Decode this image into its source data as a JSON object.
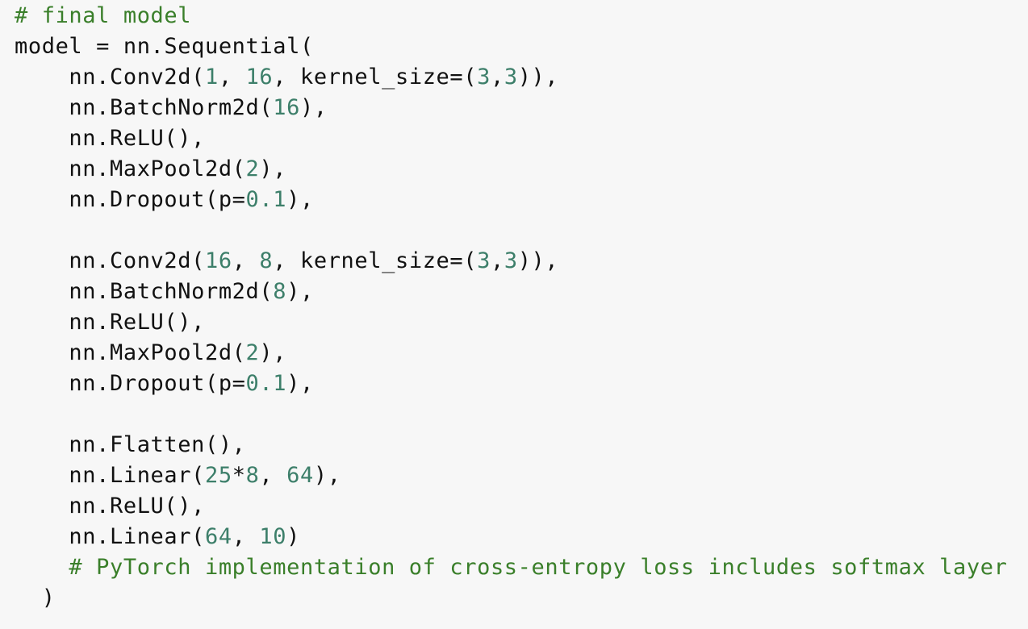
{
  "code_cell": {
    "colors": {
      "background": "#f7f7f7",
      "text": "#111111",
      "comment": "#3a7f2a",
      "number": "#3d7f6a"
    },
    "lines": [
      [
        {
          "t": "# final model",
          "c": "comment"
        }
      ],
      [
        {
          "t": "model = nn.Sequential(",
          "c": "plain"
        }
      ],
      [
        {
          "t": "    nn.Conv2d(",
          "c": "plain"
        },
        {
          "t": "1",
          "c": "num"
        },
        {
          "t": ", ",
          "c": "plain"
        },
        {
          "t": "16",
          "c": "num"
        },
        {
          "t": ", kernel_size=(",
          "c": "plain"
        },
        {
          "t": "3",
          "c": "num"
        },
        {
          "t": ",",
          "c": "plain"
        },
        {
          "t": "3",
          "c": "num"
        },
        {
          "t": ")),",
          "c": "plain"
        }
      ],
      [
        {
          "t": "    nn.BatchNorm2d(",
          "c": "plain"
        },
        {
          "t": "16",
          "c": "num"
        },
        {
          "t": "),",
          "c": "plain"
        }
      ],
      [
        {
          "t": "    nn.ReLU(),",
          "c": "plain"
        }
      ],
      [
        {
          "t": "    nn.MaxPool2d(",
          "c": "plain"
        },
        {
          "t": "2",
          "c": "num"
        },
        {
          "t": "),",
          "c": "plain"
        }
      ],
      [
        {
          "t": "    nn.Dropout(p=",
          "c": "plain"
        },
        {
          "t": "0.1",
          "c": "num"
        },
        {
          "t": "),",
          "c": "plain"
        }
      ],
      [],
      [
        {
          "t": "    nn.Conv2d(",
          "c": "plain"
        },
        {
          "t": "16",
          "c": "num"
        },
        {
          "t": ", ",
          "c": "plain"
        },
        {
          "t": "8",
          "c": "num"
        },
        {
          "t": ", kernel_size=(",
          "c": "plain"
        },
        {
          "t": "3",
          "c": "num"
        },
        {
          "t": ",",
          "c": "plain"
        },
        {
          "t": "3",
          "c": "num"
        },
        {
          "t": ")),",
          "c": "plain"
        }
      ],
      [
        {
          "t": "    nn.BatchNorm2d(",
          "c": "plain"
        },
        {
          "t": "8",
          "c": "num"
        },
        {
          "t": "),",
          "c": "plain"
        }
      ],
      [
        {
          "t": "    nn.ReLU(),",
          "c": "plain"
        }
      ],
      [
        {
          "t": "    nn.MaxPool2d(",
          "c": "plain"
        },
        {
          "t": "2",
          "c": "num"
        },
        {
          "t": "),",
          "c": "plain"
        }
      ],
      [
        {
          "t": "    nn.Dropout(p=",
          "c": "plain"
        },
        {
          "t": "0.1",
          "c": "num"
        },
        {
          "t": "),",
          "c": "plain"
        }
      ],
      [],
      [
        {
          "t": "    nn.Flatten(),",
          "c": "plain"
        }
      ],
      [
        {
          "t": "    nn.Linear(",
          "c": "plain"
        },
        {
          "t": "25",
          "c": "num"
        },
        {
          "t": "*",
          "c": "plain"
        },
        {
          "t": "8",
          "c": "num"
        },
        {
          "t": ", ",
          "c": "plain"
        },
        {
          "t": "64",
          "c": "num"
        },
        {
          "t": "),",
          "c": "plain"
        }
      ],
      [
        {
          "t": "    nn.ReLU(),",
          "c": "plain"
        }
      ],
      [
        {
          "t": "    nn.Linear(",
          "c": "plain"
        },
        {
          "t": "64",
          "c": "num"
        },
        {
          "t": ", ",
          "c": "plain"
        },
        {
          "t": "10",
          "c": "num"
        },
        {
          "t": ")",
          "c": "plain"
        }
      ],
      [
        {
          "t": "    # PyTorch implementation of cross-entropy loss includes softmax layer",
          "c": "comment"
        }
      ],
      [
        {
          "t": "  )",
          "c": "plain"
        }
      ]
    ]
  }
}
